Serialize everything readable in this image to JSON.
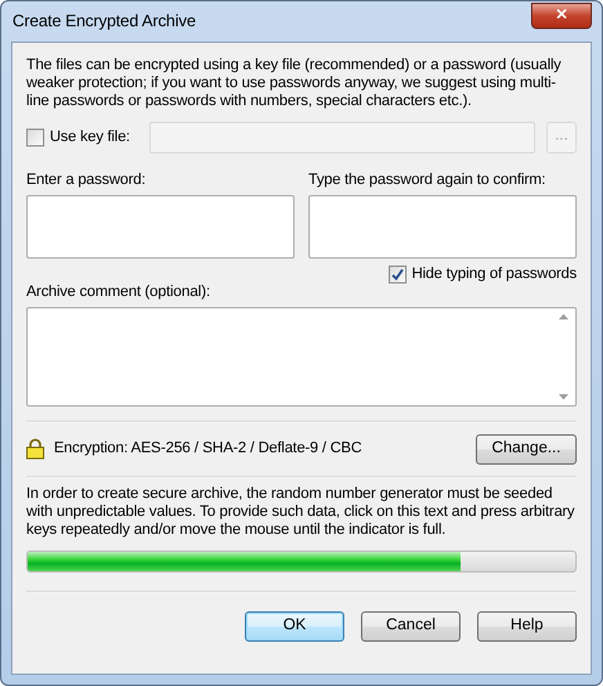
{
  "window": {
    "title": "Create Encrypted Archive",
    "close_label": "✕"
  },
  "intro": "The files can be encrypted using a key file (recommended) or a password (usually weaker protection; if you want to use passwords anyway, we suggest using multi-line passwords or passwords with numbers, special characters etc.).",
  "key_file": {
    "label": "Use key file:",
    "checked": false,
    "browse_label": "...",
    "disabled": true
  },
  "password": {
    "label": "Enter a password:"
  },
  "confirm": {
    "label": "Type the password again to confirm:"
  },
  "hide_typing": {
    "label": "Hide typing of passwords",
    "checked": true
  },
  "comment": {
    "label": "Archive comment (optional):"
  },
  "encryption": {
    "text": "Encryption: AES-256 / SHA-2 / Deflate-9 / CBC",
    "button": "Change..."
  },
  "entropy": {
    "text": "In order to create secure archive, the random number generator must be seeded with unpredictable values. To provide such data, click on this text and press arbitrary keys repeatedly and/or move the mouse until the indicator is full.",
    "level": 0.79
  },
  "buttons": [
    {
      "label": "OK",
      "default": true
    },
    {
      "label": "Cancel",
      "default": false
    },
    {
      "label": "Help",
      "default": false
    }
  ]
}
